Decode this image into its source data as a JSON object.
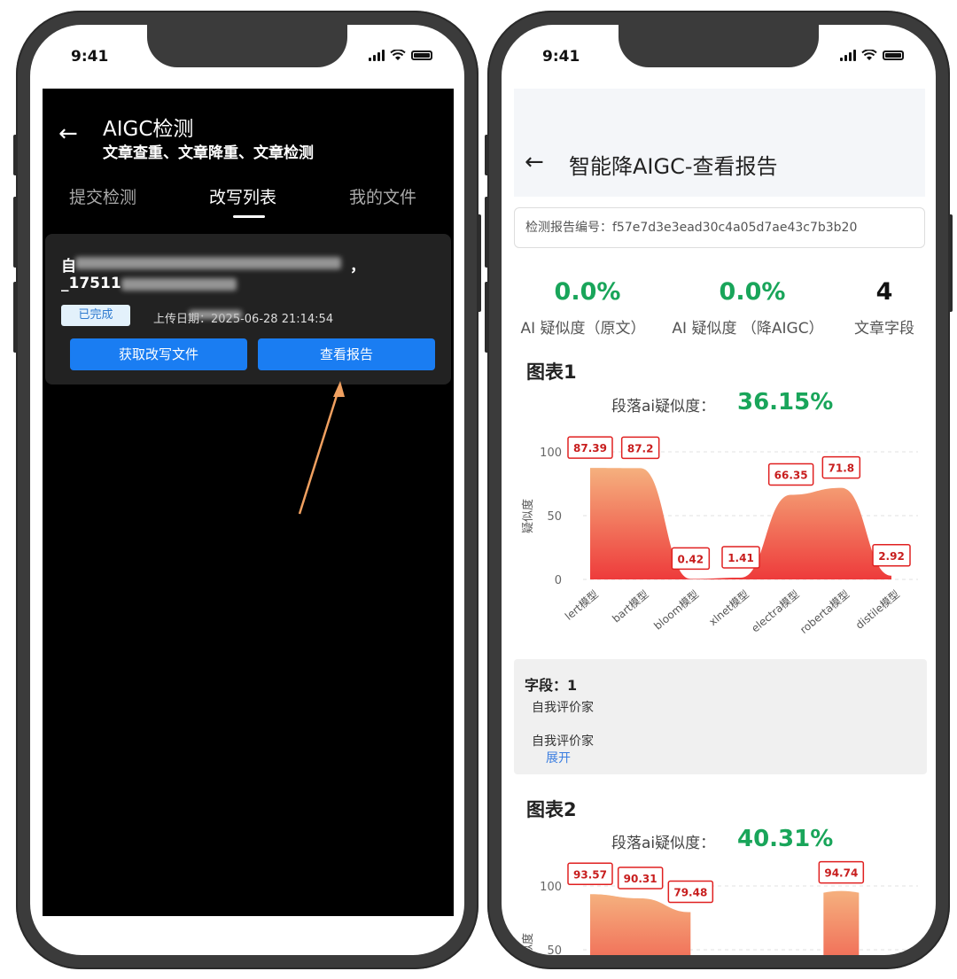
{
  "status": {
    "time": "9:41"
  },
  "left": {
    "title": "AIGC检测",
    "subtitle": "文章查重、文章降重、文章检测",
    "tabs": [
      {
        "label": "提交检测",
        "active": false
      },
      {
        "label": "改写列表",
        "active": true
      },
      {
        "label": "我的文件",
        "active": false
      }
    ],
    "card": {
      "name_line1": "自",
      "name_line1_end": "，",
      "name_line2": "_17511",
      "status": "已完成",
      "upload_label": "上传日期：",
      "upload_date": "2025-06-28 21:14:54",
      "btn_get": "获取改写文件",
      "btn_report": "查看报告"
    },
    "annotation_color": "#f0a060"
  },
  "right": {
    "title": "智能降AIGC-查看报告",
    "report_label": "检测报告编号：",
    "report_id": "f57e7d3e3ead30c4a05d7ae43c7b3b20",
    "stats": [
      {
        "value": "0.0%",
        "label": "AI 疑似度（原文）"
      },
      {
        "value": "0.0%",
        "label": "AI 疑似度 （降AIGC）"
      },
      {
        "value": "4",
        "label": "文章字段"
      }
    ],
    "field": {
      "label": "字段：",
      "number": "1",
      "text1": "自我评价家",
      "text2": "自我评价家",
      "expand": "展开"
    },
    "charts": [
      {
        "heading": "图表1",
        "para_label": "段落ai疑似度：",
        "para_value": "36.15%"
      },
      {
        "heading": "图表2",
        "para_label": "段落ai疑似度：",
        "para_value": "40.31%"
      }
    ]
  },
  "chart_data": [
    {
      "type": "area",
      "title": "",
      "ylabel": "疑似度",
      "ylim": [
        0,
        100
      ],
      "yticks": [
        "100",
        "50",
        "0"
      ],
      "categories": [
        "lert模型",
        "bart模型",
        "bloom模型",
        "xlnet模型",
        "electra模型",
        "roberta模型",
        "distile模型"
      ],
      "values": [
        87.39,
        87.2,
        0.42,
        1.41,
        66.35,
        71.8,
        2.92
      ],
      "labels": [
        "87.39",
        "87.2",
        "0.42",
        "1.41",
        "66.35",
        "71.8",
        "2.92"
      ],
      "colors": {
        "top": "#f5b07e",
        "bottom": "#ee3b3b",
        "label_border": "#e02020",
        "label_text": "#c81e1e"
      }
    },
    {
      "type": "area",
      "title": "",
      "ylabel": "疑似度",
      "ylim": [
        0,
        100
      ],
      "yticks": [
        "100",
        "50"
      ],
      "categories": [],
      "values": [
        93.57,
        90.31,
        79.48,
        null,
        null,
        94.74,
        null
      ],
      "labels": [
        "93.57",
        "90.31",
        "79.48",
        "",
        "",
        "94.74",
        ""
      ],
      "colors": {
        "top": "#f5b07e",
        "bottom": "#ee3b3b",
        "label_border": "#e02020",
        "label_text": "#c81e1e"
      }
    }
  ]
}
